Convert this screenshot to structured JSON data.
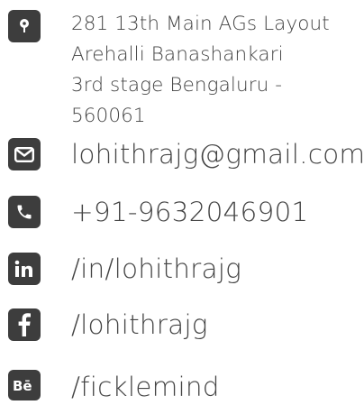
{
  "contact": {
    "address_lines": [
      "281 13th Main AGs Layout",
      "Arehalli Banashankari",
      "3rd stage Bengaluru -",
      "560061"
    ],
    "email": "lohithrajg@gmail.com",
    "phone": "+91-9632046901",
    "linkedin": "/in/lohithrajg",
    "facebook": "/lohithrajg",
    "behance": "/ficklemind"
  },
  "icons": {
    "address": "location-pin-icon",
    "email": "envelope-icon",
    "phone": "phone-icon",
    "linkedin": "linkedin-icon",
    "facebook": "facebook-icon",
    "behance": "behance-icon"
  },
  "colors": {
    "icon_bg": "#3d3d3d",
    "text": "#444444",
    "background": "#ffffff"
  }
}
